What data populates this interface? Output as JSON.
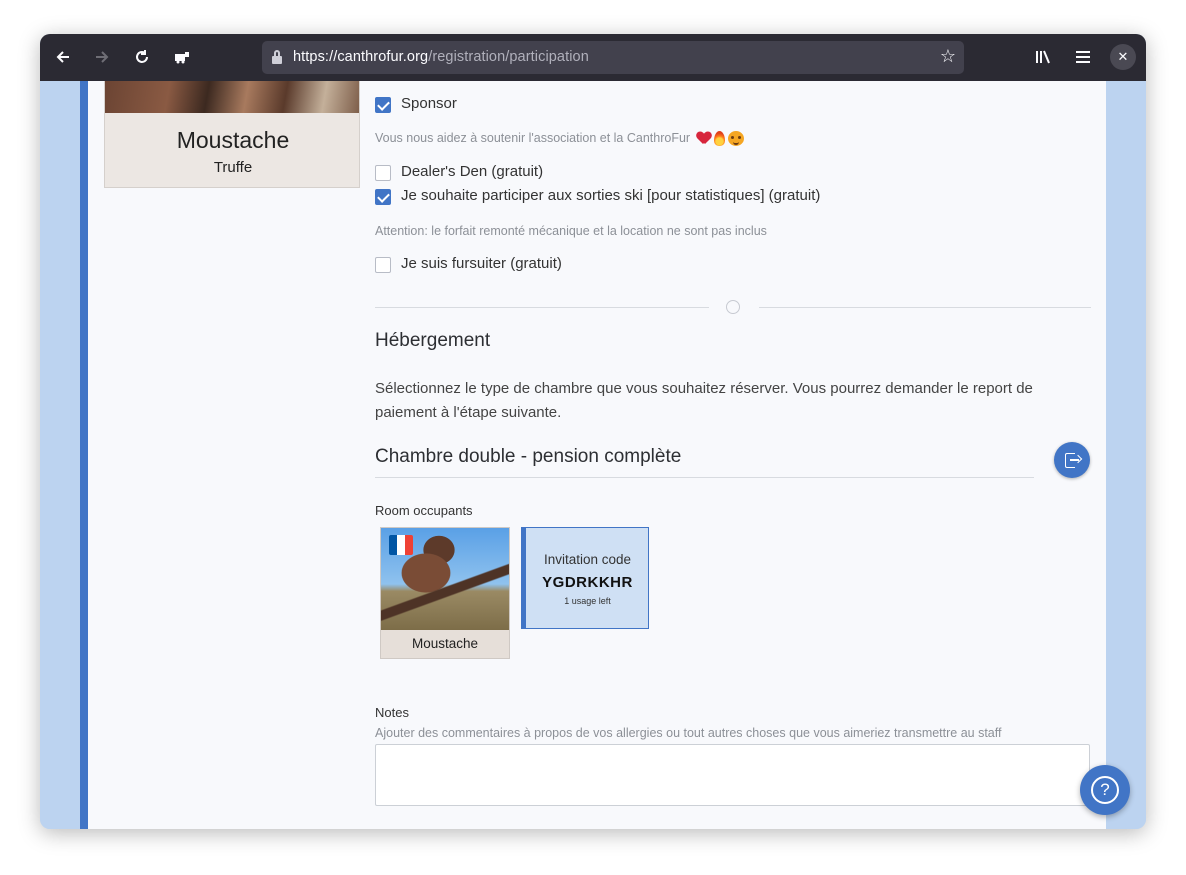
{
  "browser": {
    "url_host": "https://canthrofur.org",
    "url_path": "/registration/participation",
    "back_icon": "arrow-left-icon",
    "forward_icon": "arrow-right-icon",
    "reload_icon": "reload-icon"
  },
  "profile": {
    "name": "Moustache",
    "subtitle": "Truffe"
  },
  "options": {
    "sponsor_label": "Sponsor",
    "sponsor_checked": true,
    "sponsor_hint": "Vous nous aidez à soutenir l'association et la CanthroFur",
    "dealers_label": "Dealer's Den (gratuit)",
    "dealers_checked": false,
    "ski_label": "Je souhaite participer aux sorties ski [pour statistiques] (gratuit)",
    "ski_checked": true,
    "ski_hint": "Attention: le forfait remonté mécanique et la location ne sont pas inclus",
    "fursuiter_label": "Je suis fursuiter (gratuit)",
    "fursuiter_checked": false
  },
  "housing": {
    "title": "Hébergement",
    "description": "Sélectionnez le type de chambre que vous souhaitez réserver. Vous pourrez demander le report de paiement à l'étape suivante.",
    "room_title": "Chambre double - pension complète",
    "occupants_label": "Room occupants",
    "occupant_name": "Moustache",
    "invitation_title": "Invitation code",
    "invitation_code": "YGDRKKHR",
    "invitation_usage": "1 usage left"
  },
  "notes": {
    "label": "Notes",
    "hint": "Ajouter des commentaires à propos de vos allergies ou tout autres choses que vous aimeriez transmettre au staff",
    "value": ""
  },
  "colors": {
    "accent": "#4175c6",
    "page_bg": "#f8f9fc",
    "outer_bg": "#bcd3f0"
  }
}
